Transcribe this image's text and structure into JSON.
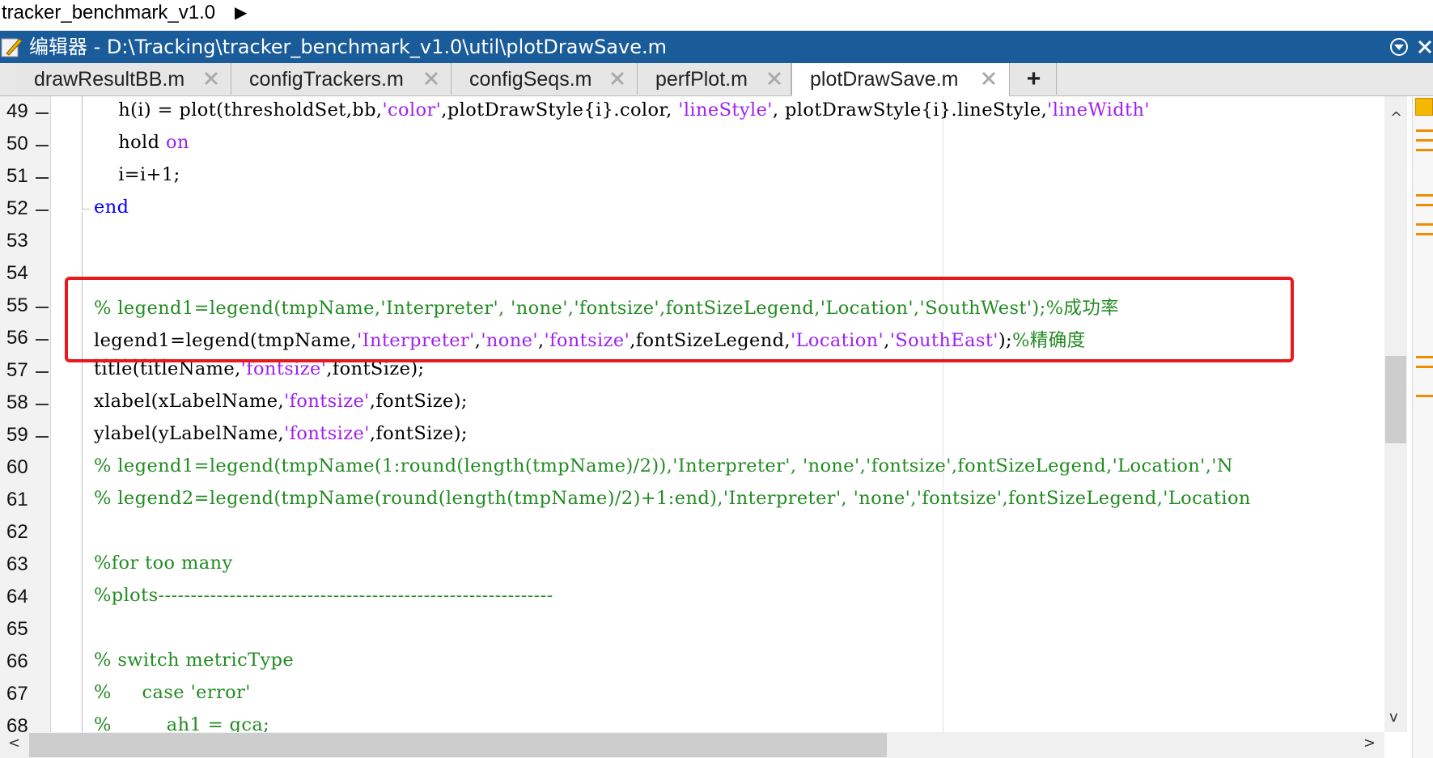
{
  "breadcrumb": {
    "text": "tracker_benchmark_v1.0"
  },
  "window": {
    "title": "编辑器 - D:\\Tracking\\tracker_benchmark_v1.0\\util\\plotDrawSave.m"
  },
  "tabs": [
    {
      "label": "drawResultBB.m"
    },
    {
      "label": "configTrackers.m"
    },
    {
      "label": "configSeqs.m"
    },
    {
      "label": "perfPlot.m"
    },
    {
      "label": "plotDrawSave.m",
      "active": true
    }
  ],
  "new_tab_label": "+",
  "line_numbers": [
    "49",
    "50",
    "51",
    "52",
    "53",
    "54",
    "55",
    "56",
    "57",
    "58",
    "59",
    "60",
    "61",
    "62",
    "63",
    "64",
    "65",
    "66",
    "67",
    "68"
  ],
  "code": {
    "l49": [
      {
        "t": "    h(i) = plot(thresholdSet,bb,",
        "c": "n"
      },
      {
        "t": "'color'",
        "c": "s"
      },
      {
        "t": ",plotDrawStyle{i}.color, ",
        "c": "n"
      },
      {
        "t": "'lineStyle'",
        "c": "s"
      },
      {
        "t": ", plotDrawStyle{i}.lineStyle,",
        "c": "n"
      },
      {
        "t": "'lineWidth'",
        "c": "s"
      }
    ],
    "l50": [
      {
        "t": "    hold ",
        "c": "n"
      },
      {
        "t": "on",
        "c": "s"
      }
    ],
    "l51": [
      {
        "t": "    i=i+1;",
        "c": "n"
      }
    ],
    "l52": [
      {
        "t": "end",
        "c": "k"
      }
    ],
    "l53": [],
    "l54": [],
    "l55": [
      {
        "t": "% legend1=legend(tmpName,'Interpreter', 'none','fontsize',fontSizeLegend,'Location','SouthWest');%成功率",
        "c": "c"
      }
    ],
    "l56": [
      {
        "t": "legend1=legend(tmpName,",
        "c": "n"
      },
      {
        "t": "'Interpreter'",
        "c": "s"
      },
      {
        "t": ",",
        "c": "n"
      },
      {
        "t": "'none'",
        "c": "s"
      },
      {
        "t": ",",
        "c": "n"
      },
      {
        "t": "'fontsize'",
        "c": "s"
      },
      {
        "t": ",fontSizeLegend,",
        "c": "n"
      },
      {
        "t": "'Location'",
        "c": "s"
      },
      {
        "t": ",",
        "c": "n"
      },
      {
        "t": "'SouthEast'",
        "c": "s"
      },
      {
        "t": ");",
        "c": "n"
      },
      {
        "t": "%精确度",
        "c": "c"
      }
    ],
    "l57": [
      {
        "t": "title(titleName,",
        "c": "n"
      },
      {
        "t": "'fontsize'",
        "c": "s"
      },
      {
        "t": ",fontSize);",
        "c": "n"
      }
    ],
    "l58": [
      {
        "t": "xlabel(xLabelName,",
        "c": "n"
      },
      {
        "t": "'fontsize'",
        "c": "s"
      },
      {
        "t": ",fontSize);",
        "c": "n"
      }
    ],
    "l59": [
      {
        "t": "ylabel(yLabelName,",
        "c": "n"
      },
      {
        "t": "'fontsize'",
        "c": "s"
      },
      {
        "t": ",fontSize);",
        "c": "n"
      }
    ],
    "l60": [
      {
        "t": "% legend1=legend(tmpName(1:round(length(tmpName)/2)),'Interpreter', 'none','fontsize',fontSizeLegend,'Location','N",
        "c": "c"
      }
    ],
    "l61": [
      {
        "t": "% legend2=legend(tmpName(round(length(tmpName)/2)+1:end),'Interpreter', 'none','fontsize',fontSizeLegend,'Location",
        "c": "c"
      }
    ],
    "l62": [],
    "l63": [
      {
        "t": "%for too many",
        "c": "c"
      }
    ],
    "l64": [
      {
        "t": "%plots-------------------------------------------------------------",
        "c": "c"
      }
    ],
    "l65": [],
    "l66": [
      {
        "t": "% switch metricType",
        "c": "c"
      }
    ],
    "l67": [
      {
        "t": "%     case 'error'",
        "c": "c"
      }
    ],
    "l68": [
      {
        "t": "%         ah1 = gca;",
        "c": "c"
      }
    ]
  },
  "colors": {
    "titlebar": "#1a5c9a",
    "keyword": "#0000ff",
    "string": "#a020f0",
    "comment": "#228b22",
    "highlight_box": "#e8181c",
    "warning_marker": "#f08c00"
  }
}
